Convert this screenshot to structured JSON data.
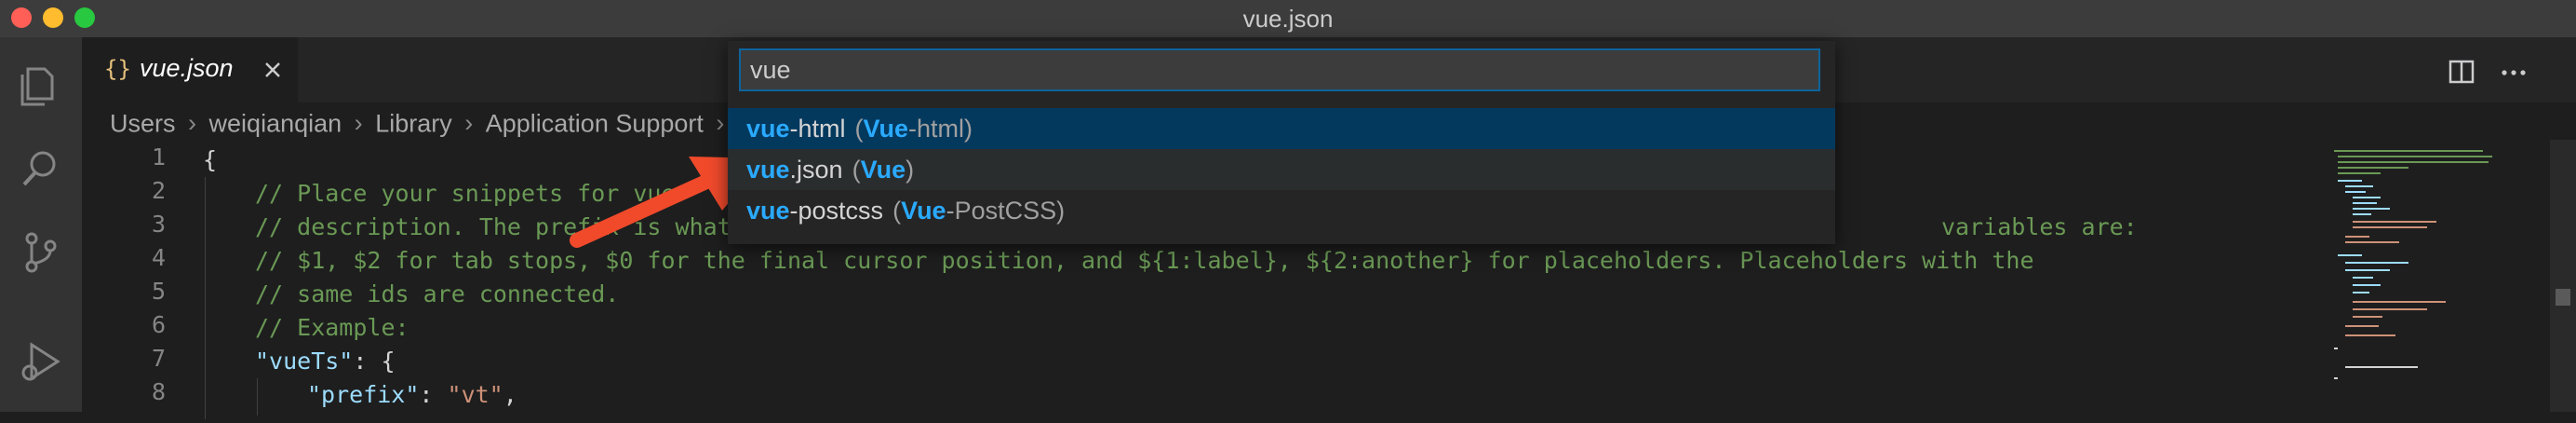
{
  "window": {
    "title": "vue.json",
    "traffic_lights": [
      "#ff5f57",
      "#febc2e",
      "#28c840"
    ]
  },
  "activity_bar": {
    "icons": [
      "files-icon",
      "search-icon",
      "source-control-icon",
      "run-debug-icon"
    ]
  },
  "tab": {
    "icon": "{}",
    "label": "vue.json"
  },
  "breadcrumb": {
    "items": [
      "Users",
      "weiqianqian",
      "Library",
      "Application Support",
      ""
    ]
  },
  "editor": {
    "line_numbers": [
      "1",
      "2",
      "3",
      "4",
      "5",
      "6",
      "7",
      "8"
    ],
    "lines": {
      "l1": "{",
      "l2": "// Place your snippets for vue",
      "l3_a": "// description. The prefix is what",
      "l3_b": "variables are:",
      "l4": "// $1, $2 for tab stops, $0 for the final cursor position, and ${1:label}, ${2:another} for placeholders. Placeholders with the",
      "l5": "// same ids are connected.",
      "l6": "// Example:",
      "l7_key": "\"vueTs\"",
      "l7_rest": ": {",
      "l8_key": "\"prefix\"",
      "l8_mid": ": ",
      "l8_val": "\"vt\"",
      "l8_end": ","
    }
  },
  "quick_pick": {
    "value": "vue",
    "items": [
      {
        "match": "vue",
        "rest": "-html",
        "desc_match": "Vue",
        "desc_rest": "-html"
      },
      {
        "match": "vue",
        "rest": ".json",
        "desc_match": "Vue",
        "desc_rest": ""
      },
      {
        "match": "vue",
        "rest": "-postcss",
        "desc_match": "Vue",
        "desc_rest": "-PostCSS"
      }
    ]
  },
  "colors": {
    "accent": "#2aaaff",
    "arrow": "#f04a2b",
    "selected_row": "#04395e"
  }
}
